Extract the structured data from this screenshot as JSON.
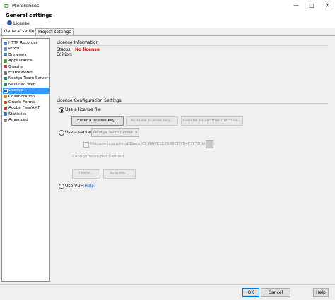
{
  "window": {
    "title": "Preferences"
  },
  "header": {
    "title": "General settings",
    "subtitle": "License"
  },
  "tabs": [
    {
      "label": "General settings",
      "active": true
    },
    {
      "label": "Project settings",
      "active": false
    }
  ],
  "sidebar": {
    "items": [
      {
        "label": "HTTP Recorder",
        "icon": "recorder-icon",
        "color": "#4a7cc7"
      },
      {
        "label": "Proxy",
        "icon": "proxy-icon",
        "color": "#6b8fc9"
      },
      {
        "label": "Browsers",
        "icon": "browser-icon",
        "color": "#3a78c2"
      },
      {
        "label": "Appearance",
        "icon": "appearance-icon",
        "color": "#5a9a3a"
      },
      {
        "label": "Graphs",
        "icon": "graph-icon",
        "color": "#c23b3b"
      },
      {
        "label": "Frameworks",
        "icon": "frameworks-icon",
        "color": "#7a7a7a"
      },
      {
        "label": "Neotys Team Server",
        "icon": "team-server-icon",
        "color": "#2e8b57"
      },
      {
        "label": "NeoLoad Web",
        "icon": "neoload-web-icon",
        "color": "#2e8b57"
      },
      {
        "label": "License",
        "icon": "license-icon",
        "color": "#2d5aa6",
        "selected": true
      },
      {
        "label": "Collaboration",
        "icon": "collaboration-icon",
        "color": "#c98a2b"
      },
      {
        "label": "Oracle Forms",
        "icon": "oracle-icon",
        "color": "#d04a2b"
      },
      {
        "label": "Adobe Flex/AMF",
        "icon": "adobe-flex-icon",
        "color": "#b33a3a"
      },
      {
        "label": "Statistics",
        "icon": "statistics-icon",
        "color": "#3a78c2"
      },
      {
        "label": "Advanced",
        "icon": "advanced-icon",
        "color": "#7a7a7a"
      }
    ]
  },
  "license_info": {
    "section_title": "License Information",
    "status_label": "Status:",
    "status_value": "No license",
    "edition_label": "Edition:"
  },
  "config": {
    "section_title": "License Configuration Settings",
    "use_license_file": "Use a license file",
    "enter_key_button": "Enter a license key...",
    "activate_button": "Activate license key...",
    "transfer_button": "Transfer to another machine...",
    "use_server": "Use a server",
    "server_dropdown": "Neotys Team Server",
    "manage_offline": "Manage licenses offline",
    "client_id": "(Client ID: 84ME5E2588CD7B4F3F7D0A8F4)",
    "configuration": "Configuration:Not Defined",
    "lease_button": "Lease...",
    "release_button": "Release...",
    "use_vuh": "Use VUH",
    "help_link": "(Help)"
  },
  "dialog_buttons": {
    "ok": "OK",
    "cancel": "Cancel",
    "help": "Help"
  },
  "colors": {
    "accent": "#3399ff",
    "error": "#e00000",
    "link": "#1a5fb4"
  }
}
